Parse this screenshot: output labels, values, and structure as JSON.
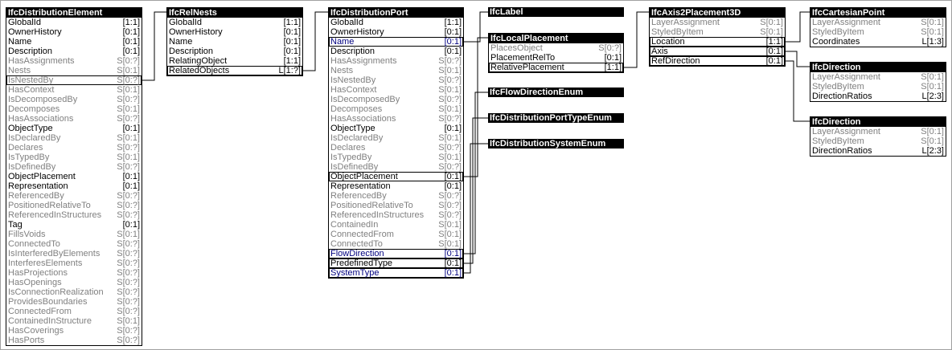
{
  "diagram": {
    "entities": [
      {
        "id": "IfcDistributionElement",
        "title": "IfcDistributionElement",
        "rows": [
          {
            "name": "GlobalId",
            "card": "[1:1]",
            "kind": "att"
          },
          {
            "name": "OwnerHistory",
            "card": "[0:1]",
            "kind": "att"
          },
          {
            "name": "Name",
            "card": "[0:1]",
            "kind": "att"
          },
          {
            "name": "Description",
            "card": "[0:1]",
            "kind": "att"
          },
          {
            "name": "HasAssignments",
            "card": "S[0:?]",
            "kind": "inv"
          },
          {
            "name": "Nests",
            "card": "S[0:1]",
            "kind": "inv"
          },
          {
            "name": "IsNestedBy",
            "card": "S[0:?]",
            "kind": "inv",
            "boxed": true
          },
          {
            "name": "HasContext",
            "card": "S[0:1]",
            "kind": "inv"
          },
          {
            "name": "IsDecomposedBy",
            "card": "S[0:?]",
            "kind": "inv"
          },
          {
            "name": "Decomposes",
            "card": "S[0:1]",
            "kind": "inv"
          },
          {
            "name": "HasAssociations",
            "card": "S[0:?]",
            "kind": "inv"
          },
          {
            "name": "ObjectType",
            "card": "[0:1]",
            "kind": "att"
          },
          {
            "name": "IsDeclaredBy",
            "card": "S[0:1]",
            "kind": "inv"
          },
          {
            "name": "Declares",
            "card": "S[0:?]",
            "kind": "inv"
          },
          {
            "name": "IsTypedBy",
            "card": "S[0:1]",
            "kind": "inv"
          },
          {
            "name": "IsDefinedBy",
            "card": "S[0:?]",
            "kind": "inv"
          },
          {
            "name": "ObjectPlacement",
            "card": "[0:1]",
            "kind": "att"
          },
          {
            "name": "Representation",
            "card": "[0:1]",
            "kind": "att"
          },
          {
            "name": "ReferencedBy",
            "card": "S[0:?]",
            "kind": "inv"
          },
          {
            "name": "PositionedRelativeTo",
            "card": "S[0:?]",
            "kind": "inv"
          },
          {
            "name": "ReferencedInStructures",
            "card": "S[0:?]",
            "kind": "inv"
          },
          {
            "name": "Tag",
            "card": "[0:1]",
            "kind": "att"
          },
          {
            "name": "FillsVoids",
            "card": "S[0:1]",
            "kind": "inv"
          },
          {
            "name": "ConnectedTo",
            "card": "S[0:?]",
            "kind": "inv"
          },
          {
            "name": "IsInterferedByElements",
            "card": "S[0:?]",
            "kind": "inv"
          },
          {
            "name": "InterferesElements",
            "card": "S[0:?]",
            "kind": "inv"
          },
          {
            "name": "HasProjections",
            "card": "S[0:?]",
            "kind": "inv"
          },
          {
            "name": "HasOpenings",
            "card": "S[0:?]",
            "kind": "inv"
          },
          {
            "name": "IsConnectionRealization",
            "card": "S[0:?]",
            "kind": "inv"
          },
          {
            "name": "ProvidesBoundaries",
            "card": "S[0:?]",
            "kind": "inv"
          },
          {
            "name": "ConnectedFrom",
            "card": "S[0:?]",
            "kind": "inv"
          },
          {
            "name": "ContainedInStructure",
            "card": "S[0:1]",
            "kind": "inv"
          },
          {
            "name": "HasCoverings",
            "card": "S[0:?]",
            "kind": "inv"
          },
          {
            "name": "HasPorts",
            "card": "S[0:?]",
            "kind": "inv"
          }
        ]
      },
      {
        "id": "IfcRelNests",
        "title": "IfcRelNests",
        "rows": [
          {
            "name": "GlobalId",
            "card": "[1:1]",
            "kind": "att"
          },
          {
            "name": "OwnerHistory",
            "card": "[0:1]",
            "kind": "att"
          },
          {
            "name": "Name",
            "card": "[0:1]",
            "kind": "att"
          },
          {
            "name": "Description",
            "card": "[0:1]",
            "kind": "att"
          },
          {
            "name": "RelatingObject",
            "card": "[1:1]",
            "kind": "att"
          },
          {
            "name": "RelatedObjects",
            "card": "L[1:?]",
            "kind": "att",
            "boxed": true
          }
        ]
      },
      {
        "id": "IfcDistributionPort",
        "title": "IfcDistributionPort",
        "rows": [
          {
            "name": "GlobalId",
            "card": "[1:1]",
            "kind": "att"
          },
          {
            "name": "OwnerHistory",
            "card": "[0:1]",
            "kind": "att"
          },
          {
            "name": "Name",
            "card": "[0:1]",
            "kind": "sel",
            "boxed": true
          },
          {
            "name": "Description",
            "card": "[0:1]",
            "kind": "att"
          },
          {
            "name": "HasAssignments",
            "card": "S[0:?]",
            "kind": "inv"
          },
          {
            "name": "Nests",
            "card": "S[0:1]",
            "kind": "inv"
          },
          {
            "name": "IsNestedBy",
            "card": "S[0:?]",
            "kind": "inv"
          },
          {
            "name": "HasContext",
            "card": "S[0:1]",
            "kind": "inv"
          },
          {
            "name": "IsDecomposedBy",
            "card": "S[0:?]",
            "kind": "inv"
          },
          {
            "name": "Decomposes",
            "card": "S[0:1]",
            "kind": "inv"
          },
          {
            "name": "HasAssociations",
            "card": "S[0:?]",
            "kind": "inv"
          },
          {
            "name": "ObjectType",
            "card": "[0:1]",
            "kind": "att"
          },
          {
            "name": "IsDeclaredBy",
            "card": "S[0:1]",
            "kind": "inv"
          },
          {
            "name": "Declares",
            "card": "S[0:?]",
            "kind": "inv"
          },
          {
            "name": "IsTypedBy",
            "card": "S[0:1]",
            "kind": "inv"
          },
          {
            "name": "IsDefinedBy",
            "card": "S[0:?]",
            "kind": "inv"
          },
          {
            "name": "ObjectPlacement",
            "card": "[0:1]",
            "kind": "att",
            "boxed": true
          },
          {
            "name": "Representation",
            "card": "[0:1]",
            "kind": "att"
          },
          {
            "name": "ReferencedBy",
            "card": "S[0:?]",
            "kind": "inv"
          },
          {
            "name": "PositionedRelativeTo",
            "card": "S[0:?]",
            "kind": "inv"
          },
          {
            "name": "ReferencedInStructures",
            "card": "S[0:?]",
            "kind": "inv"
          },
          {
            "name": "ContainedIn",
            "card": "S[0:1]",
            "kind": "inv"
          },
          {
            "name": "ConnectedFrom",
            "card": "S[0:1]",
            "kind": "inv"
          },
          {
            "name": "ConnectedTo",
            "card": "S[0:1]",
            "kind": "inv"
          },
          {
            "name": "FlowDirection",
            "card": "[0:1]",
            "kind": "sel",
            "boxed": true
          },
          {
            "name": "PredefinedType",
            "card": "[0:1]",
            "kind": "att",
            "boxed": true
          },
          {
            "name": "SystemType",
            "card": "[0:1]",
            "kind": "sel",
            "boxed": true
          }
        ]
      },
      {
        "id": "IfcLabel",
        "title": "IfcLabel",
        "rows": []
      },
      {
        "id": "IfcLocalPlacement",
        "title": "IfcLocalPlacement",
        "rows": [
          {
            "name": "PlacesObject",
            "card": "S[0:?]",
            "kind": "inv"
          },
          {
            "name": "PlacementRelTo",
            "card": "[0:1]",
            "kind": "att"
          },
          {
            "name": "RelativePlacement",
            "card": "[1:1]",
            "kind": "att",
            "boxed": true
          }
        ]
      },
      {
        "id": "IfcFlowDirectionEnum",
        "title": "IfcFlowDirectionEnum",
        "rows": []
      },
      {
        "id": "IfcDistributionPortTypeEnum",
        "title": "IfcDistributionPortTypeEnum",
        "rows": []
      },
      {
        "id": "IfcDistributionSystemEnum",
        "title": "IfcDistributionSystemEnum",
        "rows": []
      },
      {
        "id": "IfcAxis2Placement3D",
        "title": "IfcAxis2Placement3D",
        "rows": [
          {
            "name": "LayerAssignment",
            "card": "S[0:1]",
            "kind": "inv"
          },
          {
            "name": "StyledByItem",
            "card": "S[0:1]",
            "kind": "inv"
          },
          {
            "name": "Location",
            "card": "[1:1]",
            "kind": "att",
            "boxed": true
          },
          {
            "name": "Axis",
            "card": "[0:1]",
            "kind": "att",
            "boxed": true
          },
          {
            "name": "RefDirection",
            "card": "[0:1]",
            "kind": "att",
            "boxed": true
          }
        ]
      },
      {
        "id": "IfcCartesianPoint",
        "title": "IfcCartesianPoint",
        "rows": [
          {
            "name": "LayerAssignment",
            "card": "S[0:1]",
            "kind": "inv"
          },
          {
            "name": "StyledByItem",
            "card": "S[0:1]",
            "kind": "inv"
          },
          {
            "name": "Coordinates",
            "card": "L[1:3]",
            "kind": "att"
          }
        ]
      },
      {
        "id": "IfcDirection1",
        "title": "IfcDirection",
        "rows": [
          {
            "name": "LayerAssignment",
            "card": "S[0:1]",
            "kind": "inv"
          },
          {
            "name": "StyledByItem",
            "card": "S[0:1]",
            "kind": "inv"
          },
          {
            "name": "DirectionRatios",
            "card": "L[2:3]",
            "kind": "att"
          }
        ]
      },
      {
        "id": "IfcDirection2",
        "title": "IfcDirection",
        "rows": [
          {
            "name": "LayerAssignment",
            "card": "S[0:1]",
            "kind": "inv"
          },
          {
            "name": "StyledByItem",
            "card": "S[0:1]",
            "kind": "inv"
          },
          {
            "name": "DirectionRatios",
            "card": "L[2:3]",
            "kind": "att"
          }
        ]
      }
    ],
    "colors": {
      "header_bg": "#000000",
      "header_text": "#ffffff",
      "attribute_text": "#000000",
      "inverse_text": "#808080",
      "selected_text": "#000080",
      "border": "#000000"
    }
  }
}
